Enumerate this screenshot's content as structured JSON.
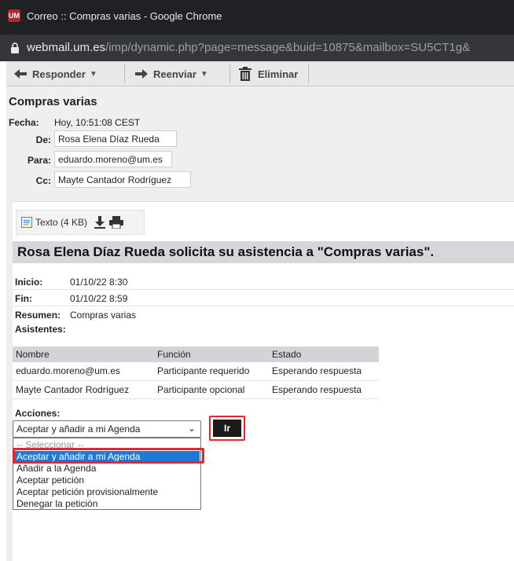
{
  "browser": {
    "title": "Correo :: Compras varias - Google Chrome",
    "favicon": "UM",
    "url_host": "webmail.um.es",
    "url_path": "/imp/dynamic.php?page=message&buid=10875&mailbox=SU5CT1g&"
  },
  "toolbar": {
    "reply_label": "Responder",
    "forward_label": "Reenviar",
    "delete_label": "Eliminar"
  },
  "message": {
    "subject": "Compras varias",
    "date_label": "Fecha:",
    "date_value": "Hoy, 10:51:08 CEST",
    "from_label": "De:",
    "from_value": "Rosa Elena Díaz Rueda",
    "to_label": "Para:",
    "to_value": "eduardo.moreno@um.es",
    "cc_label": "Cc:",
    "cc_value": "Mayte Cantador Rodríguez"
  },
  "attachment": {
    "label": "Texto (4 KB)"
  },
  "invitation": {
    "banner": "Rosa Elena Díaz Rueda solicita su asistencia a \"Compras varias\".",
    "start_label": "Inicio:",
    "start_value": "01/10/22 8:30",
    "end_label": "Fin:",
    "end_value": "01/10/22 8:59",
    "summary_label": "Resumen:",
    "summary_value": "Compras varias",
    "attendees_label": "Asistentes:",
    "columns": [
      "Nombre",
      "Función",
      "Estado"
    ],
    "rows": [
      [
        "eduardo.moreno@um.es",
        "Participante requerido",
        "Esperando respuesta"
      ],
      [
        "Mayte Cantador Rodríguez",
        "Participante opcional",
        "Esperando respuesta"
      ]
    ]
  },
  "actions": {
    "label": "Acciones:",
    "selected": "Aceptar y añadir a mi Agenda",
    "go_label": "Ir",
    "options": [
      "-- Seleccionar --",
      "Aceptar y añadir a mi Agenda",
      "Añadir a la Agenda",
      "Aceptar petición",
      "Aceptar petición provisionalmente",
      "Denegar la petición"
    ]
  },
  "colors": {
    "highlight_red": "#e5262e",
    "selection_blue": "#1e78d6"
  }
}
